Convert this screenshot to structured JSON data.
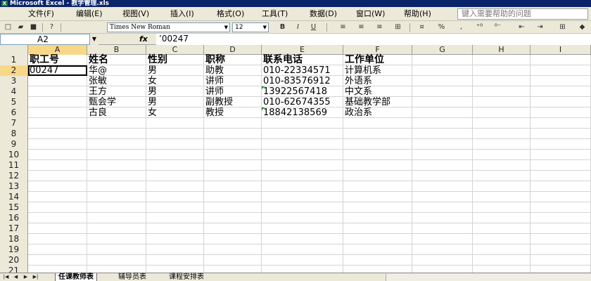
{
  "window": {
    "title": "Microsoft Excel - 教学管理.xls",
    "app_icon": "excel-icon"
  },
  "menu": {
    "items": [
      "文件(F)",
      "编辑(E)",
      "视图(V)",
      "插入(I)",
      "格式(O)",
      "工具(T)",
      "数据(D)",
      "窗口(W)",
      "帮助(H)"
    ],
    "help_placeholder": "键入需要帮助的问题"
  },
  "toolbar": {
    "font_name": "Times New Roman",
    "font_size": "12",
    "bold": "B",
    "italic": "I",
    "underline": "U",
    "percent": "%",
    "comma": ","
  },
  "formula_bar": {
    "name_box": "A2",
    "fx": "fx",
    "content": "’00247"
  },
  "grid": {
    "columns": [
      "A",
      "B",
      "C",
      "D",
      "E",
      "F",
      "G",
      "H",
      "I"
    ],
    "active_column": "A",
    "active_row": 2,
    "row_count": 22,
    "rows": [
      [
        "职工号",
        "姓名",
        "性别",
        "职称",
        "联系电话",
        "工作单位"
      ],
      [
        "00247",
        "华@",
        "男",
        "助教",
        "010-22334571",
        "计算机系"
      ],
      [
        "",
        "张敏",
        "女",
        "讲师",
        "010-83576912",
        "外语系"
      ],
      [
        "",
        "王方",
        "男",
        "讲师",
        "13922567418",
        "中文系"
      ],
      [
        "",
        "甄会学",
        "男",
        "副教授",
        "010-62674355",
        "基础教学部"
      ],
      [
        "",
        "古良",
        "女",
        "教授",
        "18842138569",
        "政治系"
      ]
    ]
  },
  "sheets": {
    "tabs": [
      "任课教师表",
      "辅导员表",
      "课程安排表"
    ],
    "active_index": 0
  },
  "colors": {
    "titlebar": "#0a246a",
    "chrome": "#ece9d8",
    "active_header": "#f8d888",
    "text_number_indicator": "#1a8a2e"
  }
}
